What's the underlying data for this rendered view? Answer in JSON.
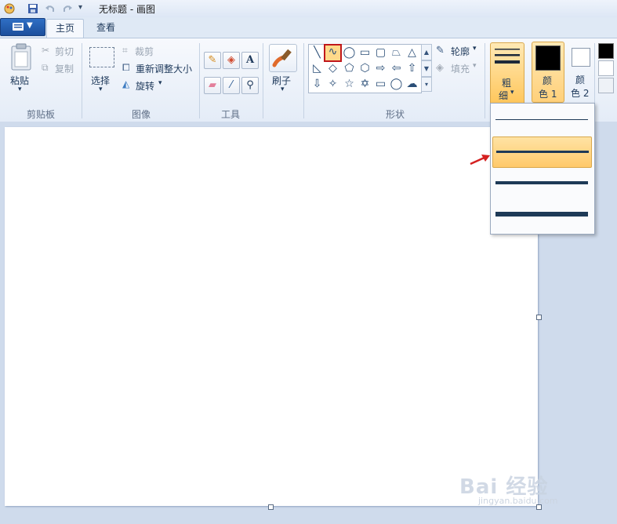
{
  "window": {
    "title": "无标题 - 画图"
  },
  "tabs": [
    {
      "label": "主页"
    },
    {
      "label": "查看"
    }
  ],
  "clipboard": {
    "paste": "粘贴",
    "cut": "剪切",
    "copy": "复制",
    "group": "剪贴板"
  },
  "image": {
    "select": "选择",
    "crop": "裁剪",
    "resize": "重新调整大小",
    "rotate": "旋转",
    "group": "图像"
  },
  "tools": {
    "group": "工具",
    "text_glyph": "A"
  },
  "brushes": {
    "label": "刷子"
  },
  "shapes": {
    "outline": "轮廓",
    "fill": "填充",
    "group": "形状"
  },
  "size": {
    "label_top": "粗",
    "label_bottom": "细"
  },
  "colors": {
    "color1_top": "颜",
    "color1_bottom": "色 1",
    "color2_top": "颜",
    "color2_bottom": "色 2",
    "color1_value": "#000000",
    "color2_value": "#ffffff"
  },
  "size_options": [
    {
      "id": "1px"
    },
    {
      "id": "3px",
      "selected": true
    },
    {
      "id": "5px"
    },
    {
      "id": "8px"
    }
  ],
  "watermark": {
    "text": "Bai 经验",
    "sub": "jingyan.baidu.com"
  },
  "accent": {
    "selected_bg": "#ffc96a",
    "highlight_border": "#d42020"
  }
}
